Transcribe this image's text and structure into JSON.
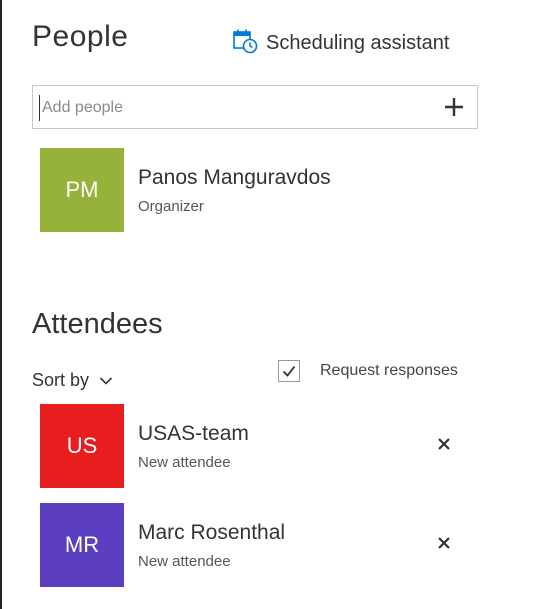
{
  "header": {
    "title": "People",
    "scheduling_label": "Scheduling assistant"
  },
  "add_people": {
    "placeholder": "Add people"
  },
  "organizer": {
    "initials": "PM",
    "name": "Panos Manguravdos",
    "role": "Organizer",
    "color": "#97b23a"
  },
  "attendees_section": {
    "title": "Attendees",
    "sort_label": "Sort by",
    "request_responses_label": "Request responses",
    "request_responses_checked": true
  },
  "attendees": [
    {
      "initials": "US",
      "name": "USAS-team",
      "status": "New attendee",
      "color": "#e81e1e"
    },
    {
      "initials": "MR",
      "name": "Marc Rosenthal",
      "status": "New attendee",
      "color": "#5c3fc0"
    }
  ],
  "colors": {
    "accent": "#0078d7"
  }
}
